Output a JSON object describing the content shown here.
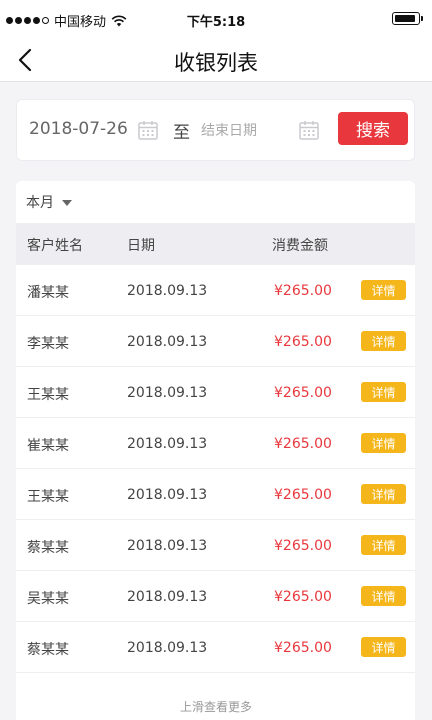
{
  "status_bar": {
    "carrier": "中国移动",
    "time": "下午5:18"
  },
  "nav": {
    "title": "收银列表"
  },
  "search": {
    "start_date": "2018-07-26",
    "to_label": "至",
    "end_date_placeholder": "结束日期",
    "search_label": "搜索"
  },
  "filter": {
    "selected": "本月"
  },
  "table": {
    "headers": {
      "name": "客户姓名",
      "date": "日期",
      "amount": "消费金额"
    },
    "detail_label": "详情",
    "rows": [
      {
        "name": "潘某某",
        "date": "2018.09.13",
        "amount": "¥265.00"
      },
      {
        "name": "李某某",
        "date": "2018.09.13",
        "amount": "¥265.00"
      },
      {
        "name": "王某某",
        "date": "2018.09.13",
        "amount": "¥265.00"
      },
      {
        "name": "崔某某",
        "date": "2018.09.13",
        "amount": "¥265.00"
      },
      {
        "name": "王某某",
        "date": "2018.09.13",
        "amount": "¥265.00"
      },
      {
        "name": "蔡某某",
        "date": "2018.09.13",
        "amount": "¥265.00"
      },
      {
        "name": "吴某某",
        "date": "2018.09.13",
        "amount": "¥265.00"
      },
      {
        "name": "蔡某某",
        "date": "2018.09.13",
        "amount": "¥265.00"
      }
    ]
  },
  "footer": {
    "hint": "上滑查看更多"
  },
  "colors": {
    "accent_red": "#e8383d",
    "detail_yellow": "#f5b61b",
    "header_bg": "#eeeef2"
  },
  "icons": {
    "back": "chevron-left-icon",
    "calendar": "calendar-icon",
    "dropdown": "caret-down-icon"
  }
}
